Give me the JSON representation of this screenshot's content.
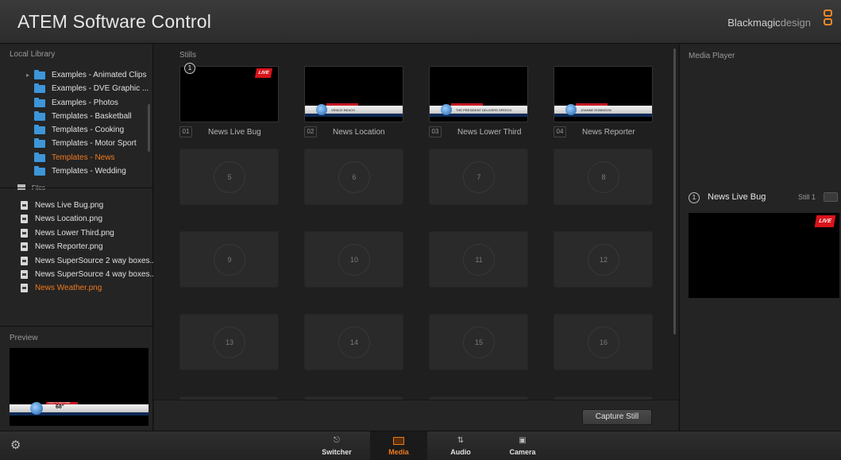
{
  "app": {
    "title": "ATEM Software Control",
    "brand_bold": "Blackmagic",
    "brand_light": "design"
  },
  "library": {
    "label": "Local Library",
    "folders": [
      {
        "label": "Examples - Animated Clips"
      },
      {
        "label": "Examples - DVE Graphic ..."
      },
      {
        "label": "Examples - Photos"
      },
      {
        "label": "Templates - Basketball"
      },
      {
        "label": "Templates - Cooking"
      },
      {
        "label": "Templates - Motor Sport"
      },
      {
        "label": "Templates - News"
      },
      {
        "label": "Templates - Wedding"
      }
    ],
    "active_folder": "Templates - News",
    "files_label": "Files",
    "files": [
      {
        "label": "News Live Bug.png"
      },
      {
        "label": "News Location.png"
      },
      {
        "label": "News Lower Third.png"
      },
      {
        "label": "News Reporter.png"
      },
      {
        "label": "News SuperSource 2 way boxes...."
      },
      {
        "label": "News SuperSource 4 way boxes...."
      },
      {
        "label": "News Weather.png"
      }
    ],
    "active_file": "News Weather.png"
  },
  "preview": {
    "label": "Preview",
    "lower_third_temp": "68°",
    "lower_third_tag": "TODAY'S WEATHER"
  },
  "stills": {
    "label": "Stills",
    "filled": [
      {
        "num": "01",
        "name": "News Live Bug",
        "badge": "LIVE"
      },
      {
        "num": "02",
        "name": "News Location",
        "caption": "VENICE BEACH"
      },
      {
        "num": "03",
        "name": "News Lower Third",
        "caption": "THE PRESIDENT DELIVERS SPEECH"
      },
      {
        "num": "04",
        "name": "News Reporter",
        "caption": "JOANNE ROBINSON"
      }
    ],
    "selected_badge": "1",
    "empty": [
      "5",
      "6",
      "7",
      "8",
      "9",
      "10",
      "11",
      "12",
      "13",
      "14",
      "15",
      "16"
    ],
    "capture_label": "Capture Still"
  },
  "media_player": {
    "label": "Media Player",
    "index": "1",
    "name": "News Live Bug",
    "still_label": "Still 1",
    "badge": "LIVE"
  },
  "nav": {
    "items": [
      {
        "label": "Switcher",
        "icon": "switcher-icon"
      },
      {
        "label": "Media",
        "icon": "media-icon"
      },
      {
        "label": "Audio",
        "icon": "audio-icon"
      },
      {
        "label": "Camera",
        "icon": "camera-icon"
      }
    ],
    "active": "Media"
  },
  "colors": {
    "accent": "#f07a1e",
    "folder": "#3d96d8",
    "live_red": "#d8131b"
  }
}
